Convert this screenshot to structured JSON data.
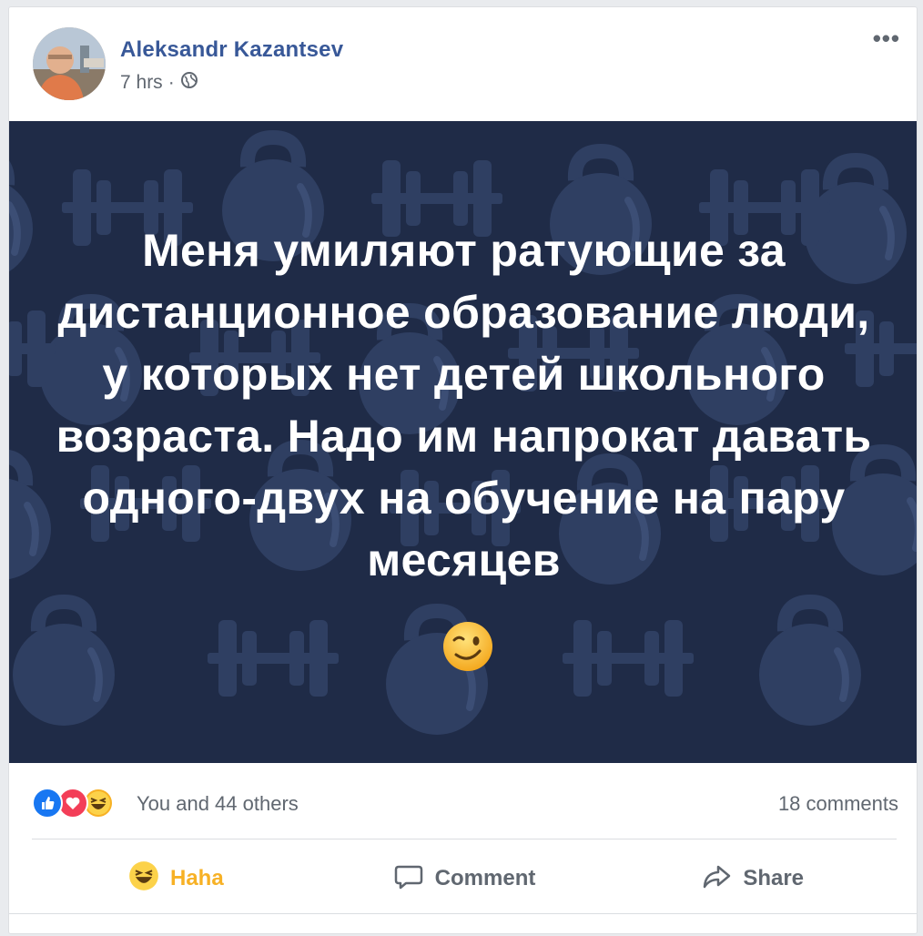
{
  "post": {
    "author": "Aleksandr Kazantsev",
    "time": "7 hrs",
    "separator": "·",
    "privacy_icon": "globe-icon",
    "more_label": "•••"
  },
  "banner": {
    "text": "Меня умиляют ратующие за дистанционное образование люди, у которых нет детей школьного возраста. Надо им напрокат давать одного-двух на обучение на пару месяцев",
    "emoji_icon": "winking-face-icon",
    "background": "#1f2b47",
    "pattern_color": "#2f3f62"
  },
  "stats": {
    "reaction_icons": [
      "like-icon",
      "love-icon",
      "haha-icon"
    ],
    "reactions_text": "You and 44 others",
    "comments_text": "18 comments"
  },
  "actions": {
    "haha_label": "Haha",
    "comment_label": "Comment",
    "share_label": "Share"
  },
  "colors": {
    "link": "#385898",
    "like": "#1877f2",
    "love": "#f33e58",
    "haha": "#f7b125"
  }
}
